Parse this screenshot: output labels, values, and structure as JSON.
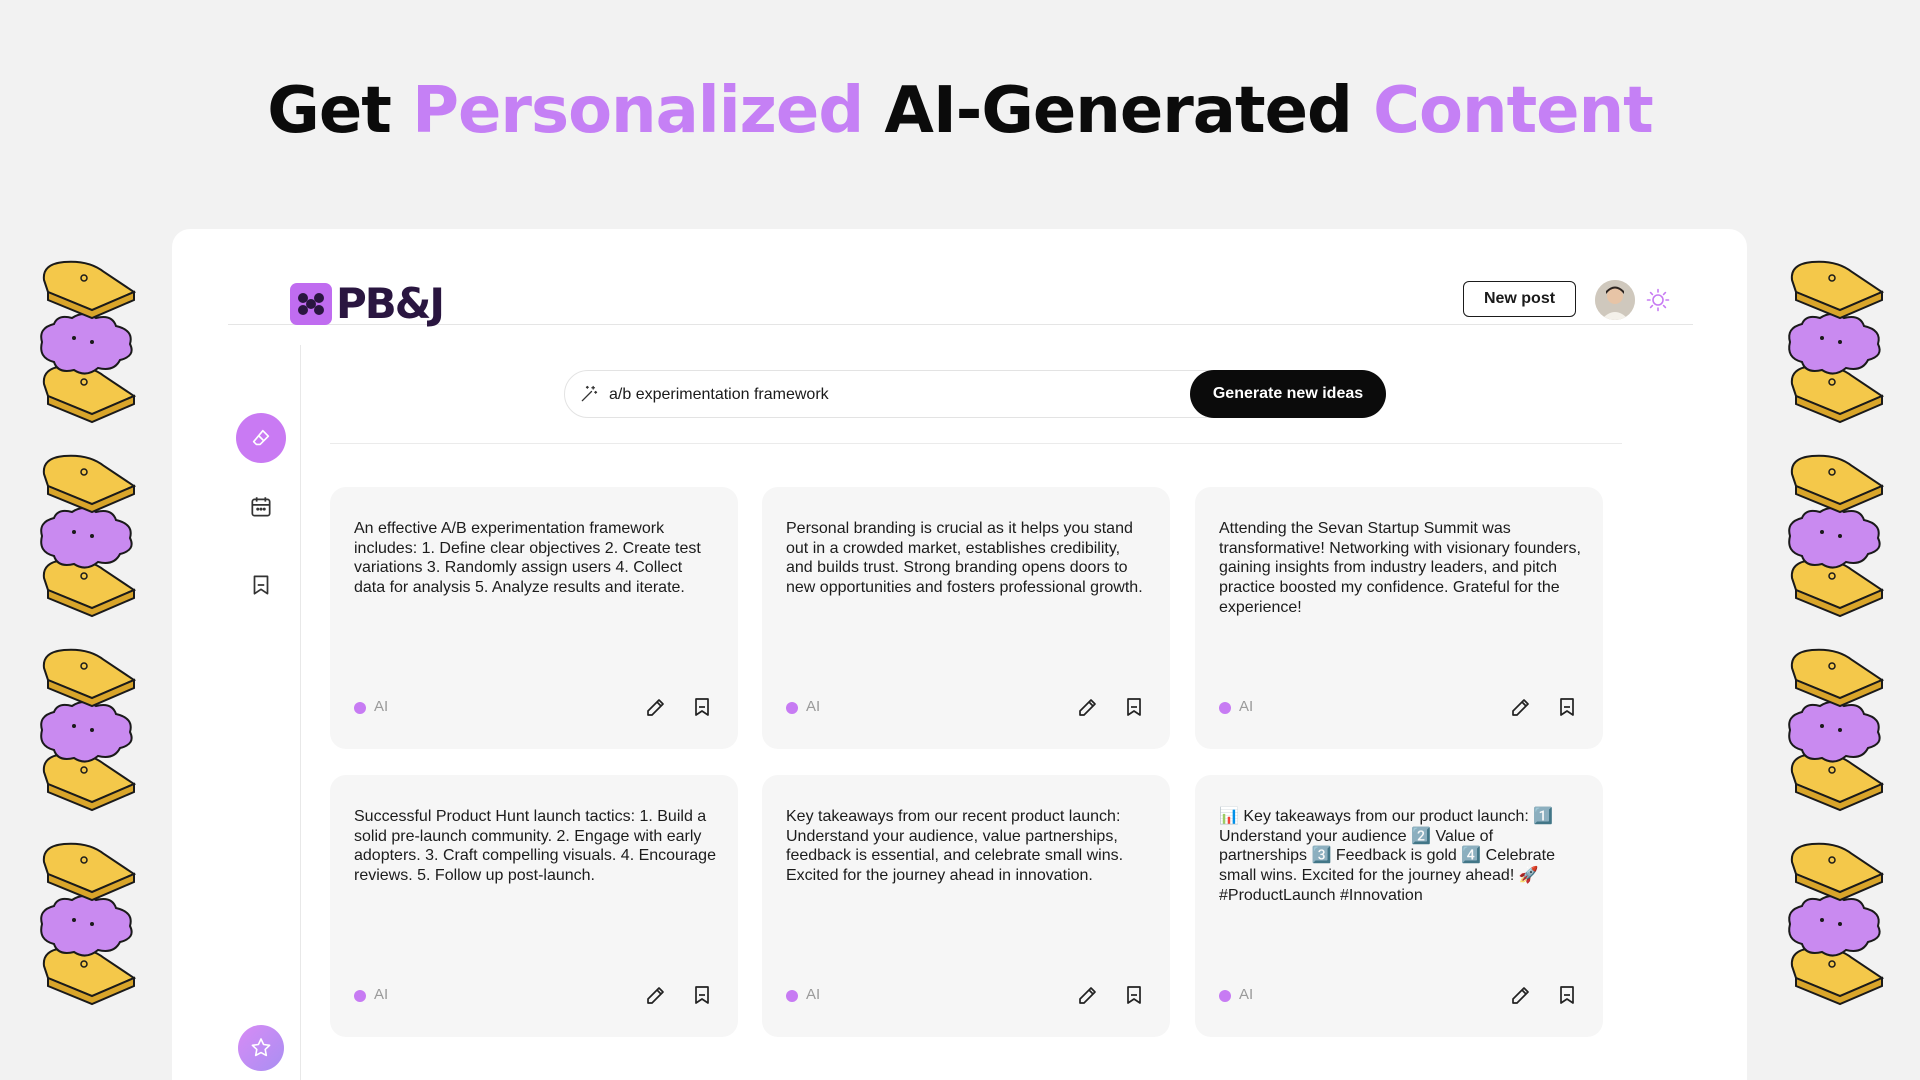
{
  "headline": {
    "part1": "Get",
    "accent1": "Personalized",
    "part2": "AI-Generated",
    "accent2": "Content"
  },
  "colors": {
    "accent": "#c580f5",
    "brand": "#c06cf0",
    "brand_text": "#2a1640",
    "dark_button": "#0b0b0b",
    "card_bg": "#f6f6f6"
  },
  "header": {
    "logo_text": "PB&J",
    "new_post_label": "New post",
    "avatar_icon": "user-avatar",
    "theme_icon": "sun-icon"
  },
  "sidebar": {
    "items": [
      {
        "name": "ideas",
        "icon": "eraser-icon",
        "active": true
      },
      {
        "name": "calendar",
        "icon": "calendar-icon",
        "active": false
      },
      {
        "name": "saved",
        "icon": "bookmark-icon",
        "active": false
      }
    ],
    "bottom_icon": "star-icon"
  },
  "search": {
    "value": "a/b experimentation framework",
    "icon": "magic-wand-icon",
    "button_label": "Generate new ideas"
  },
  "cards": [
    {
      "text": "An effective A/B experimentation framework includes: 1. Define clear objectives 2. Create test variations 3. Randomly assign users 4. Collect data for analysis 5. Analyze results and iterate.",
      "tag": "AI"
    },
    {
      "text": "Personal branding is crucial as it helps you stand out in a crowded market, establishes credibility, and builds trust. Strong branding opens doors to new opportunities and fosters professional growth.",
      "tag": "AI"
    },
    {
      "text": "Attending the Sevan Startup Summit was transformative! Networking with visionary founders, gaining insights from industry leaders, and pitch practice boosted my confidence. Grateful for the experience!",
      "tag": "AI"
    },
    {
      "text": "Successful Product Hunt launch tactics: 1. Build a solid pre-launch community. 2. Engage with early adopters. 3. Craft compelling visuals. 4. Encourage reviews. 5. Follow up post-launch.",
      "tag": "AI"
    },
    {
      "text": "Key takeaways from our recent product launch: Understand your audience, value partnerships, feedback is essential, and celebrate small wins. Excited for the journey ahead in innovation.",
      "tag": "AI"
    },
    {
      "text": "📊 Key takeaways from our product launch: 1️⃣ Understand your audience 2️⃣ Value of partnerships 3️⃣ Feedback is gold 4️⃣ Celebrate small wins. Excited for the journey ahead! 🚀 #ProductLaunch #Innovation",
      "tag": "AI"
    }
  ]
}
